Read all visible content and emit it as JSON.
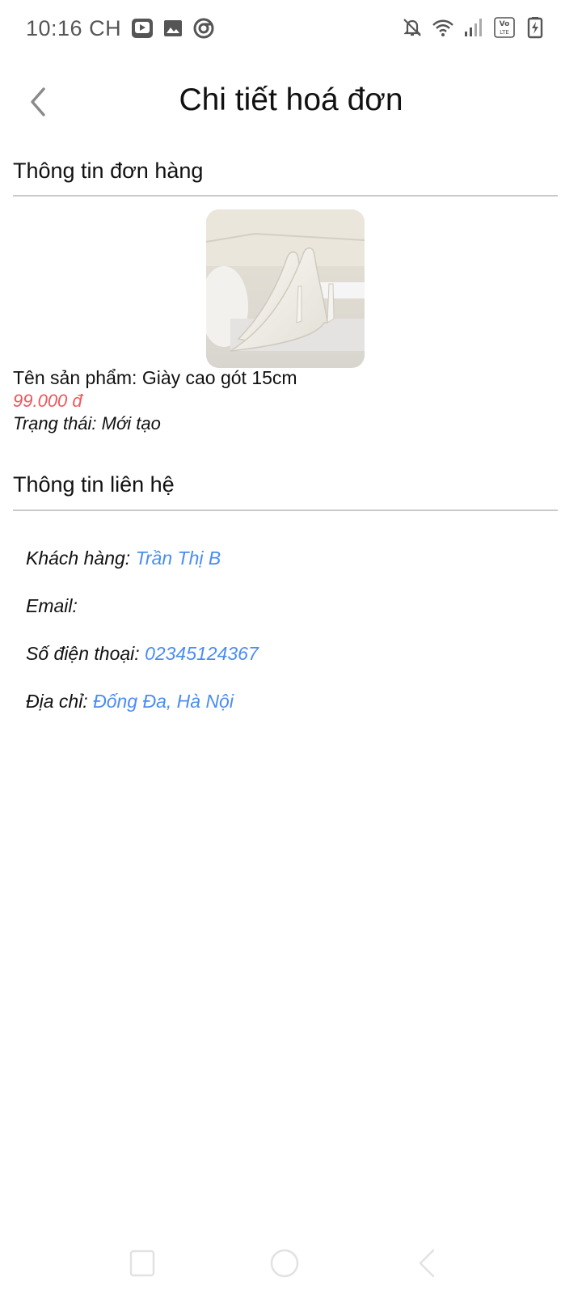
{
  "status_bar": {
    "time": "10:16 CH",
    "icons_left": [
      "video-app-icon",
      "gallery-icon",
      "browser-icon"
    ],
    "icons_right": [
      "bell-off-icon",
      "wifi-icon",
      "signal-icon",
      "volte-icon",
      "battery-icon"
    ],
    "volte_label": "Vo LTE"
  },
  "header": {
    "title": "Chi tiết hoá đơn",
    "back_icon": "chevron-left-icon"
  },
  "order_section": {
    "title": "Thông tin đơn hàng",
    "product_image_alt": "Giày cao gót 15cm",
    "product_name_label": "Tên sản phẩm: ",
    "product_name": "Giày cao gót 15cm",
    "price": "99.000 đ",
    "status_label": "Trạng thái: ",
    "status": "Mới tạo"
  },
  "contact_section": {
    "title": "Thông tin liên hệ",
    "customer_label": "Khách hàng:",
    "customer": "Trần Thị B",
    "email_label": "Email:",
    "email": "",
    "phone_label": "Số điện thoại:",
    "phone": "02345124367",
    "address_label": "Địa chỉ:",
    "address": "Đống Đa, Hà Nội"
  },
  "colors": {
    "price": "#f2555a",
    "link_value": "#4a8df0",
    "divider": "#c9c9c9"
  },
  "nav_bar": {
    "icons": [
      "recents-square-icon",
      "home-circle-icon",
      "back-triangle-icon"
    ]
  }
}
